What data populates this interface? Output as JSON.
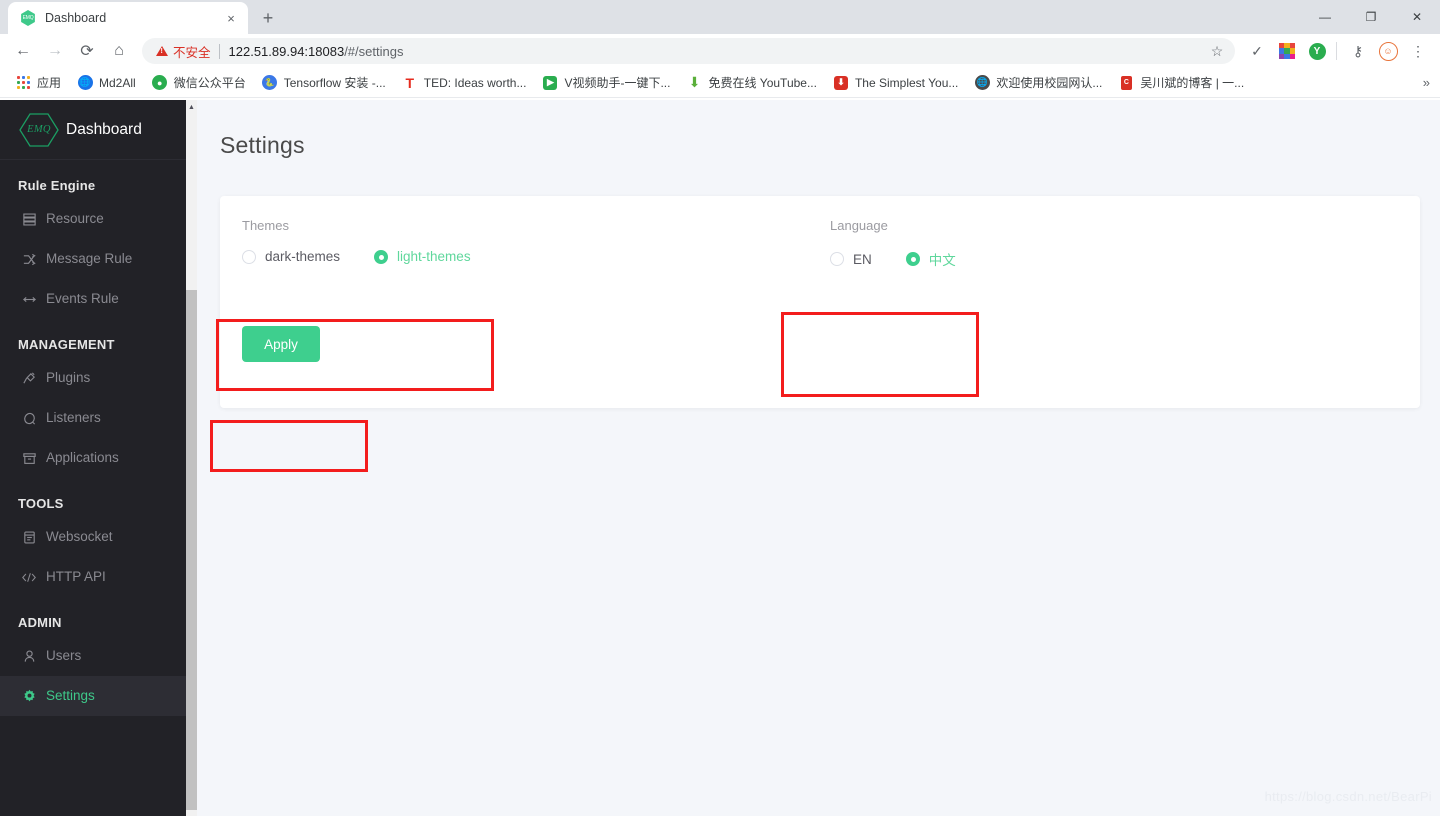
{
  "browser": {
    "tab": {
      "title": "Dashboard",
      "favicon_text": "EMQ",
      "close_label": "×"
    },
    "new_tab_label": "+",
    "window_controls": {
      "minimize": "—",
      "maximize": "❐",
      "close": "✕"
    },
    "nav": {
      "back": "←",
      "forward": "→",
      "reload": "⟳",
      "home": "⌂"
    },
    "omnibox": {
      "security_label": "不安全",
      "url_host": "122.51.89.94:18083",
      "url_path": "/#/settings",
      "star": "☆"
    },
    "toolbar_icons": [
      {
        "name": "check-icon",
        "glyph": "✓"
      },
      {
        "name": "color-grid-extension-icon",
        "glyph": ""
      },
      {
        "name": "green-circle-extension-icon",
        "glyph": "Y"
      },
      {
        "name": "password-key-icon",
        "glyph": "⚷"
      },
      {
        "name": "profile-avatar-icon",
        "glyph": "☺"
      },
      {
        "name": "chrome-menu-icon",
        "glyph": "⋮"
      }
    ],
    "bookmarks": [
      {
        "label": "应用",
        "icon": "apps-grid-icon",
        "color": "#4285f4"
      },
      {
        "label": "Md2All",
        "icon": "globe-icon",
        "color": "#1a73e8"
      },
      {
        "label": "微信公众平台",
        "icon": "wechat-icon",
        "color": "#2aad4f"
      },
      {
        "label": "Tensorflow 安装 -...",
        "icon": "python-icon",
        "color": "#ffd43b"
      },
      {
        "label": "TED: Ideas worth...",
        "icon": "ted-icon",
        "color": "#e62b1e"
      },
      {
        "label": "V视频助手-一键下...",
        "icon": "video-icon",
        "color": "#2aad4f"
      },
      {
        "label": "免费在线 YouTube...",
        "icon": "download-icon",
        "color": "#5aaf3a"
      },
      {
        "label": "The Simplest You...",
        "icon": "download-red-icon",
        "color": "#d93025"
      },
      {
        "label": "欢迎使用校园网认...",
        "icon": "globe-dark-icon",
        "color": "#4a4a4a"
      },
      {
        "label": "吴川斌的博客 | 一...",
        "icon": "csdn-icon",
        "color": "#d93025"
      }
    ],
    "bookmarks_overflow": "»"
  },
  "app": {
    "logo": {
      "mark_text": "EMQ",
      "title": "Dashboard"
    },
    "sidebar": {
      "sections": [
        {
          "title": "Rule Engine",
          "items": [
            {
              "label": "Resource",
              "icon": "resource-stack-icon",
              "active": false
            },
            {
              "label": "Message Rule",
              "icon": "shuffle-icon",
              "active": false
            },
            {
              "label": "Events Rule",
              "icon": "double-arrow-icon",
              "active": false
            }
          ]
        },
        {
          "title": "MANAGEMENT",
          "items": [
            {
              "label": "Plugins",
              "icon": "plug-icon",
              "active": false
            },
            {
              "label": "Listeners",
              "icon": "satellite-icon",
              "active": false
            },
            {
              "label": "Applications",
              "icon": "archive-box-icon",
              "active": false
            }
          ]
        },
        {
          "title": "TOOLS",
          "items": [
            {
              "label": "Websocket",
              "icon": "browser-window-icon",
              "active": false
            },
            {
              "label": "HTTP API",
              "icon": "code-brackets-icon",
              "active": false
            }
          ]
        },
        {
          "title": "ADMIN",
          "items": [
            {
              "label": "Users",
              "icon": "user-icon",
              "active": false
            },
            {
              "label": "Settings",
              "icon": "gear-icon",
              "active": true
            }
          ]
        }
      ]
    },
    "page": {
      "title": "Settings",
      "themes": {
        "label": "Themes",
        "options": [
          {
            "label": "dark-themes",
            "selected": false
          },
          {
            "label": "light-themes",
            "selected": true
          }
        ]
      },
      "language": {
        "label": "Language",
        "options": [
          {
            "label": "EN",
            "selected": false
          },
          {
            "label": "中文",
            "selected": true
          }
        ]
      },
      "apply_label": "Apply"
    },
    "watermark": "https://blog.csdn.net/BearPi",
    "colors": {
      "accent_green": "#3ecf8e",
      "sidebar_bg": "#222227",
      "page_bg": "#f4f6fa",
      "annotation_red": "#f31d1d"
    }
  }
}
